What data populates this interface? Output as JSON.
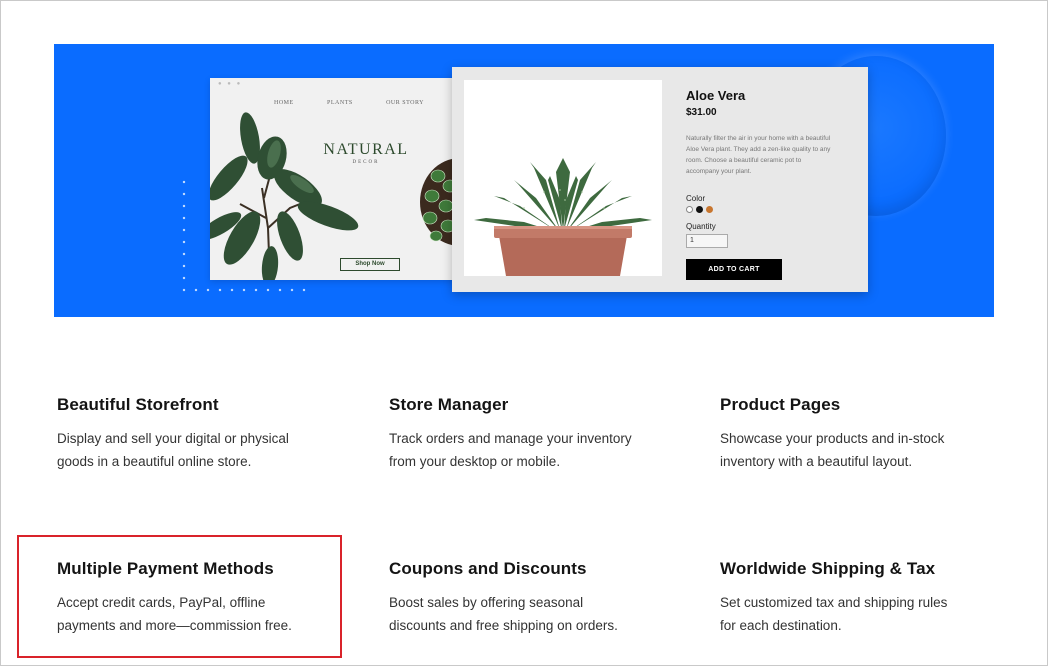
{
  "hero": {
    "store": {
      "nav": [
        "HOME",
        "PLANTS",
        "OUR STORY"
      ],
      "title": "NATURAL",
      "subtitle": "DECOR",
      "shop_button": "Shop Now"
    },
    "product": {
      "name": "Aloe Vera",
      "price": "$31.00",
      "description": "Naturally filter the air in your home with a beautiful Aloe Vera plant. They add a zen-like quality to any room. Choose a beautiful ceramic pot to accompany your plant.",
      "color_label": "Color",
      "colors": [
        "#ffffff",
        "#111111",
        "#c8762f"
      ],
      "quantity_label": "Quantity",
      "quantity_value": "1",
      "add_to_cart": "ADD TO CART"
    },
    "colors": {
      "banner": "#0a6cff"
    }
  },
  "features": [
    {
      "title": "Beautiful Storefront",
      "line1": "Display and sell your digital or physical",
      "line2": "goods in a beautiful online store."
    },
    {
      "title": "Store Manager",
      "line1": "Track orders and manage your inventory",
      "line2": "from your desktop or mobile."
    },
    {
      "title": "Product Pages",
      "line1": "Showcase your products and in-stock",
      "line2": "inventory with a beautiful layout."
    },
    {
      "title": "Multiple Payment Methods",
      "line1": "Accept credit cards, PayPal, offline",
      "line2": "payments and more—commission free."
    },
    {
      "title": "Coupons and Discounts",
      "line1": "Boost sales by offering seasonal",
      "line2": "discounts and free shipping on orders."
    },
    {
      "title": "Worldwide Shipping & Tax",
      "line1": "Set customized tax and shipping rules",
      "line2": "for each destination."
    }
  ],
  "highlight": {
    "color": "#d9232a"
  }
}
